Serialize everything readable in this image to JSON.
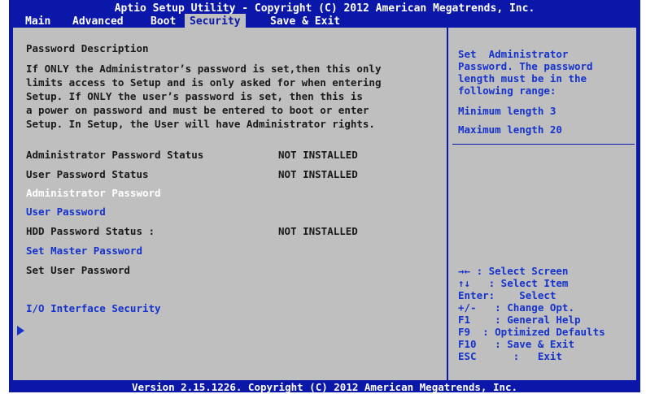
{
  "header": {
    "title": "Aptio Setup Utility - Copyright (C) 2012 American Megatrends, Inc."
  },
  "menu": {
    "items": [
      {
        "label": "Main"
      },
      {
        "label": "Advanced"
      },
      {
        "label": "Boot"
      },
      {
        "label": "Security"
      },
      {
        "label": "Save & Exit"
      }
    ],
    "active": "Security"
  },
  "main": {
    "description_title": "Password Description",
    "description_lines": [
      "If ONLY the Administrator’s password is set,then this only",
      "limits access to Setup and is only asked for when entering",
      "Setup. If ONLY the user’s password is set, then this is",
      "a power on password and must be entered to boot or enter",
      "Setup. In Setup, the User will have Administrator rights."
    ],
    "admin_status_label": "Administrator Password Status",
    "admin_status_value": "NOT INSTALLED",
    "user_status_label": "User Password Status",
    "user_status_value": "NOT INSTALLED",
    "admin_password": "Administrator Password",
    "user_password": "User Password",
    "hdd_status_label": "HDD Password Status :",
    "hdd_status_value": "NOT INSTALLED",
    "set_master": "Set Master Password",
    "set_user": "Set User Password",
    "io_security": "I/O Interface Security"
  },
  "help": {
    "description": [
      "Set  Administrator",
      "Password. The password",
      "length must be in the",
      "following range:"
    ],
    "min_length": "Minimum length 3",
    "max_length": "Maximum length 20",
    "keys": [
      "→← : Select Screen",
      "↑↓   : Select Item",
      "Enter:    Select",
      "+/-   : Change Opt.",
      "F1    : General Help",
      "F9  : Optimized Defaults",
      "F10   : Save & Exit",
      "ESC      :   Exit"
    ]
  },
  "footer": {
    "text": "Version 2.15.1226. Copyright (C) 2012 American Megatrends, Inc."
  }
}
